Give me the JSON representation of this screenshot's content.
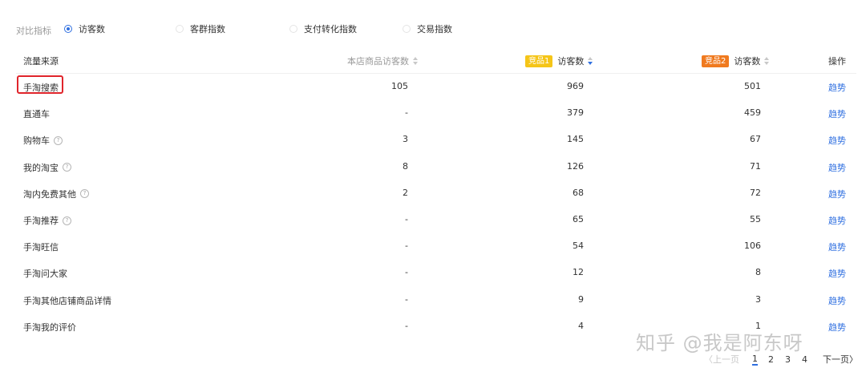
{
  "metrics": {
    "label": "对比指标",
    "options": [
      {
        "label": "访客数",
        "checked": true
      },
      {
        "label": "客群指数",
        "checked": false
      },
      {
        "label": "支付转化指数",
        "checked": false
      },
      {
        "label": "交易指数",
        "checked": false
      }
    ]
  },
  "table": {
    "headers": {
      "source": "流量来源",
      "store": "本店商品访客数",
      "comp1_badge": "竞品1",
      "comp1": "访客数",
      "comp2_badge": "竞品2",
      "comp2": "访客数",
      "action": "操作"
    },
    "badge_colors": {
      "comp1": "#f5c518",
      "comp2": "#f07a1f"
    },
    "rows": [
      {
        "source": "手淘搜索",
        "help": false,
        "store": "105",
        "comp1": "969",
        "comp2": "501",
        "action": "趋势"
      },
      {
        "source": "直通车",
        "help": false,
        "store": "-",
        "comp1": "379",
        "comp2": "459",
        "action": "趋势"
      },
      {
        "source": "购物车",
        "help": true,
        "store": "3",
        "comp1": "145",
        "comp2": "67",
        "action": "趋势"
      },
      {
        "source": "我的淘宝",
        "help": true,
        "store": "8",
        "comp1": "126",
        "comp2": "71",
        "action": "趋势"
      },
      {
        "source": "淘内免费其他",
        "help": true,
        "store": "2",
        "comp1": "68",
        "comp2": "72",
        "action": "趋势"
      },
      {
        "source": "手淘推荐",
        "help": true,
        "store": "-",
        "comp1": "65",
        "comp2": "55",
        "action": "趋势"
      },
      {
        "source": "手淘旺信",
        "help": false,
        "store": "-",
        "comp1": "54",
        "comp2": "106",
        "action": "趋势"
      },
      {
        "source": "手淘问大家",
        "help": false,
        "store": "-",
        "comp1": "12",
        "comp2": "8",
        "action": "趋势"
      },
      {
        "source": "手淘其他店铺商品详情",
        "help": false,
        "store": "-",
        "comp1": "9",
        "comp2": "3",
        "action": "趋势"
      },
      {
        "source": "手淘我的评价",
        "help": false,
        "store": "-",
        "comp1": "4",
        "comp2": "1",
        "action": "趋势"
      }
    ]
  },
  "pagination": {
    "prev": "〈上一页",
    "pages": [
      "1",
      "2",
      "3",
      "4"
    ],
    "current": "1",
    "next": "下一页〉"
  },
  "watermark": "知乎 @我是阿东呀"
}
